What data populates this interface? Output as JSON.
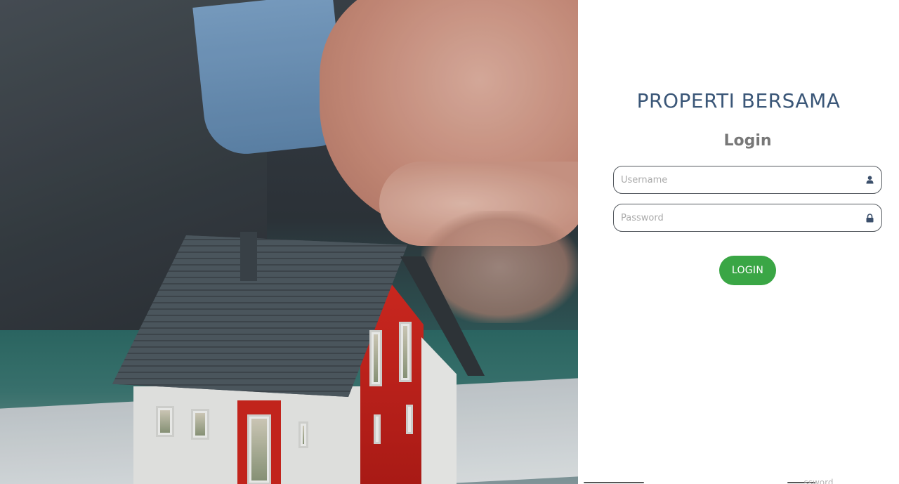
{
  "brand": {
    "title": "PROPERTI BERSAMA"
  },
  "form": {
    "heading": "Login",
    "username_placeholder": "Username",
    "password_placeholder": "Password",
    "submit_label": "LOGIN",
    "forgot_label": "...ssword"
  },
  "icons": {
    "user": "user-icon",
    "password": "lock-icon"
  },
  "colors": {
    "brand": "#3b5778",
    "button": "#3aa645",
    "heading": "#777777"
  }
}
